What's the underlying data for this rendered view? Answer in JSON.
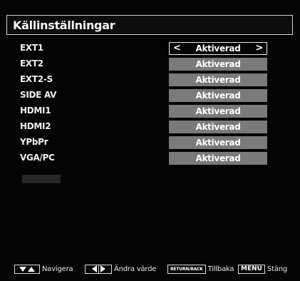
{
  "title": "Källinställningar",
  "sources": [
    {
      "label": "EXT1",
      "value": "Aktiverad",
      "selected": true
    },
    {
      "label": "EXT2",
      "value": "Aktiverad",
      "selected": false
    },
    {
      "label": "EXT2-S",
      "value": "Aktiverad",
      "selected": false
    },
    {
      "label": "SIDE AV",
      "value": "Aktiverad",
      "selected": false
    },
    {
      "label": "HDMI1",
      "value": "Aktiverad",
      "selected": false
    },
    {
      "label": "HDMI2",
      "value": "Aktiverad",
      "selected": false
    },
    {
      "label": "YPbPr",
      "value": "Aktiverad",
      "selected": false
    },
    {
      "label": "VGA/PC",
      "value": "Aktiverad",
      "selected": false
    }
  ],
  "selector_arrows": {
    "left": "<",
    "right": ">"
  },
  "footer": {
    "navigate_label": "Navigera",
    "change_value_label": "Ändra värde",
    "back_key": "RETURN/BACK",
    "back_label": "Tillbaka",
    "menu_key": "MENU",
    "close_label": "Stäng"
  },
  "colors": {
    "background": "#050505",
    "value_box": "#7a7a7a",
    "text": "#f0f0f0",
    "border": "#cfcfcf"
  },
  "icons": {
    "navigate": "up-down-arrows-icon",
    "change_value": "left-right-arrows-icon"
  }
}
